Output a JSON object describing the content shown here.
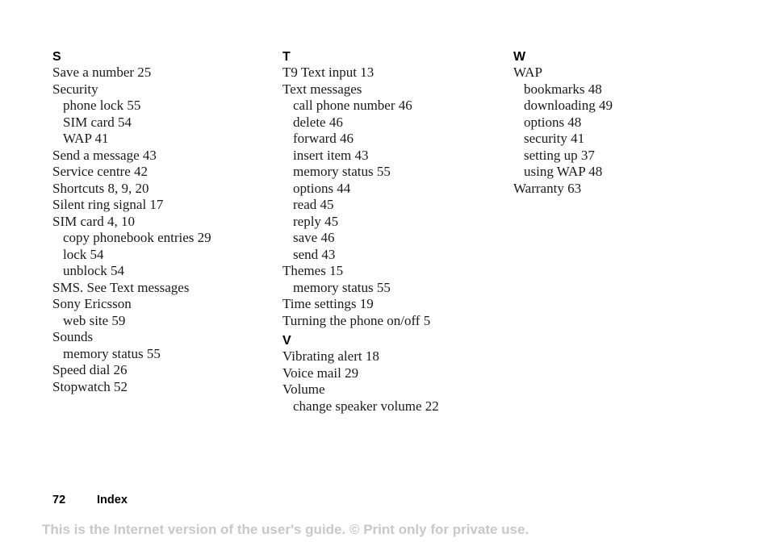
{
  "columns": [
    {
      "sections": [
        {
          "letter": "S",
          "entries": [
            {
              "text": "Save a number 25",
              "level": 0
            },
            {
              "text": "Security",
              "level": 0
            },
            {
              "text": "phone lock 55",
              "level": 1
            },
            {
              "text": "SIM card 54",
              "level": 1
            },
            {
              "text": "WAP 41",
              "level": 1
            },
            {
              "text": "Send a message 43",
              "level": 0
            },
            {
              "text": "Service centre 42",
              "level": 0
            },
            {
              "text": "Shortcuts 8, 9, 20",
              "level": 0
            },
            {
              "text": "Silent ring signal 17",
              "level": 0
            },
            {
              "text": "SIM card 4, 10",
              "level": 0
            },
            {
              "text": "copy phonebook entries 29",
              "level": 1
            },
            {
              "text": "lock 54",
              "level": 1
            },
            {
              "text": "unblock 54",
              "level": 1
            },
            {
              "text": "SMS. See Text messages",
              "level": 0
            },
            {
              "text": "Sony Ericsson",
              "level": 0
            },
            {
              "text": "web site 59",
              "level": 1
            },
            {
              "text": "Sounds",
              "level": 0
            },
            {
              "text": "memory status 55",
              "level": 1
            },
            {
              "text": "Speed dial 26",
              "level": 0
            },
            {
              "text": "Stopwatch 52",
              "level": 0
            }
          ]
        }
      ]
    },
    {
      "sections": [
        {
          "letter": "T",
          "entries": [
            {
              "text": "T9 Text input 13",
              "level": 0
            },
            {
              "text": "Text messages",
              "level": 0
            },
            {
              "text": "call phone number 46",
              "level": 1
            },
            {
              "text": "delete 46",
              "level": 1
            },
            {
              "text": "forward 46",
              "level": 1
            },
            {
              "text": "insert item 43",
              "level": 1
            },
            {
              "text": "memory status 55",
              "level": 1
            },
            {
              "text": "options 44",
              "level": 1
            },
            {
              "text": "read 45",
              "level": 1
            },
            {
              "text": "reply 45",
              "level": 1
            },
            {
              "text": "save 46",
              "level": 1
            },
            {
              "text": "send 43",
              "level": 1
            },
            {
              "text": "Themes 15",
              "level": 0
            },
            {
              "text": "memory status 55",
              "level": 1
            },
            {
              "text": "Time settings 19",
              "level": 0
            },
            {
              "text": "Turning the phone on/off 5",
              "level": 0
            }
          ]
        },
        {
          "letter": "V",
          "entries": [
            {
              "text": "Vibrating alert 18",
              "level": 0
            },
            {
              "text": "Voice mail 29",
              "level": 0
            },
            {
              "text": "Volume",
              "level": 0
            },
            {
              "text": "change speaker volume 22",
              "level": 1
            }
          ]
        }
      ]
    },
    {
      "sections": [
        {
          "letter": "W",
          "entries": [
            {
              "text": "WAP",
              "level": 0
            },
            {
              "text": "bookmarks 48",
              "level": 1
            },
            {
              "text": "downloading 49",
              "level": 1
            },
            {
              "text": "options 48",
              "level": 1
            },
            {
              "text": "security 41",
              "level": 1
            },
            {
              "text": "setting up 37",
              "level": 1
            },
            {
              "text": "using WAP 48",
              "level": 1
            },
            {
              "text": "Warranty 63",
              "level": 0
            }
          ]
        }
      ]
    }
  ],
  "footer": {
    "page_number": "72",
    "section_title": "Index"
  },
  "disclaimer": "This is the Internet version of the user's guide. © Print only for private use.",
  "colors": {
    "text": "#1a1a1a",
    "disclaimer": "#c8c8c8"
  }
}
